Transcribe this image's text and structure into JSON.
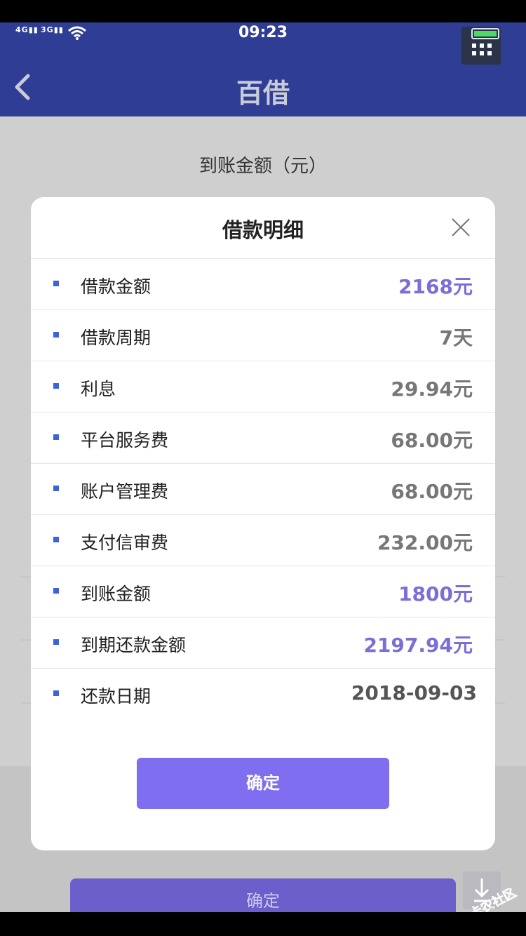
{
  "status_bar": {
    "signal_1": "4G",
    "signal_2": "3G",
    "time": "09:23"
  },
  "header": {
    "title": "百借",
    "back_icon": "chevron-left-icon"
  },
  "background_page": {
    "received_amount_label": "到账金额（元）",
    "confirm_label": "确定"
  },
  "modal": {
    "title": "借款明细",
    "close_icon": "close-icon",
    "rows": [
      {
        "label": "借款金额",
        "value": "2168元",
        "accent": true
      },
      {
        "label": "借款周期",
        "value": "7天",
        "accent": false
      },
      {
        "label": "利息",
        "value": "29.94元",
        "accent": false
      },
      {
        "label": "平台服务费",
        "value": "68.00元",
        "accent": false
      },
      {
        "label": "账户管理费",
        "value": "68.00元",
        "accent": false
      },
      {
        "label": "支付信审费",
        "value": "232.00元",
        "accent": false
      },
      {
        "label": "到账金额",
        "value": "1800元",
        "accent": true
      },
      {
        "label": "到期还款金额",
        "value": "2197.94元",
        "accent": true
      },
      {
        "label": "还款日期",
        "value": "2018-09-03",
        "accent": false
      }
    ],
    "confirm_label": "确定"
  },
  "watermark": {
    "text": "卡农社区"
  },
  "colors": {
    "header_bg": "#2f3e94",
    "accent_value": "#7a6fd6",
    "confirm_button": "#7f6eef",
    "bullet": "#3d63d8"
  }
}
